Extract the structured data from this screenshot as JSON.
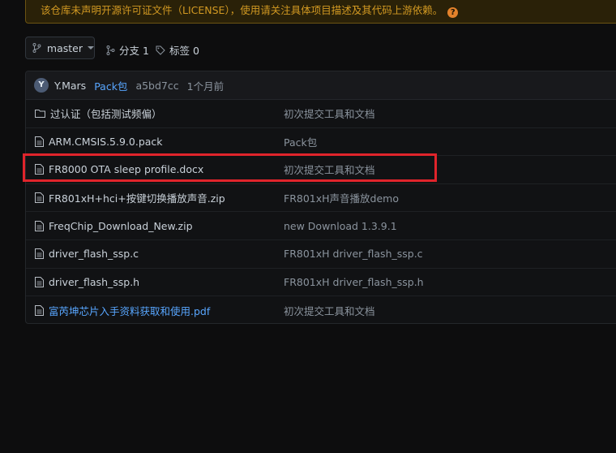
{
  "banner": {
    "text": "该仓库未声明开源许可证文件（LICENSE），使用请关注具体项目描述及其代码上游依赖。",
    "help_icon": "?",
    "color": "#d29922"
  },
  "toolbar": {
    "branch_label": "master",
    "branches_label": "分支 1",
    "tags_label": "标签 0"
  },
  "commit": {
    "avatar_letter": "Y",
    "author": "Y.Mars",
    "message": "Pack包",
    "hash": "a5bd7cc",
    "time": "1个月前"
  },
  "files": [
    {
      "name": "过认证（包括测试频偏）",
      "message": "初次提交工具和文档",
      "type": "folder",
      "link": false
    },
    {
      "name": "ARM.CMSIS.5.9.0.pack",
      "message": "Pack包",
      "type": "file",
      "link": false
    },
    {
      "name": "FR8000 OTA sleep profile.docx",
      "message": "初次提交工具和文档",
      "type": "file",
      "link": false
    },
    {
      "name": "FR801xH+hci+按键切换播放声音.zip",
      "message": "FR801xH声音播放demo",
      "type": "file",
      "link": false
    },
    {
      "name": "FreqChip_Download_New.zip",
      "message": "new Download 1.3.9.1",
      "type": "file",
      "link": false
    },
    {
      "name": "driver_flash_ssp.c",
      "message": "FR801xH driver_flash_ssp.c",
      "type": "file",
      "link": false
    },
    {
      "name": "driver_flash_ssp.h",
      "message": "FR801xH driver_flash_ssp.h",
      "type": "file",
      "link": false
    },
    {
      "name": "富芮坤芯片入手资料获取和使用.pdf",
      "message": "初次提交工具和文档",
      "type": "file",
      "link": true
    }
  ],
  "colors": {
    "highlight": "#e0242b",
    "link": "#58a6ff",
    "background": "#0d0d0e"
  }
}
